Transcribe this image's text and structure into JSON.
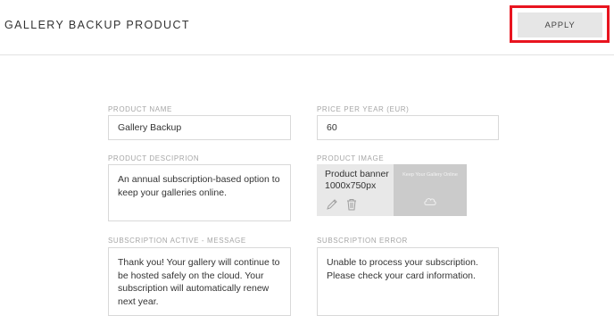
{
  "header": {
    "title": "GALLERY BACKUP PRODUCT",
    "apply_label": "APPLY",
    "highlight_color": "#e8141f"
  },
  "form": {
    "product_name": {
      "label": "PRODUCT NAME",
      "value": "Gallery Backup"
    },
    "price_per_year": {
      "label": "PRICE PER YEAR (EUR)",
      "value": "60"
    },
    "product_description": {
      "label": "PRODUCT DESCIPRION",
      "value": "An annual subscription-based option to keep your galleries online."
    },
    "product_image": {
      "label": "PRODUCT IMAGE",
      "banner_text": "Product banner 1000x750px",
      "thumbnail_caption": "Keep Your Gallery Online",
      "icons": [
        "pencil-icon",
        "trash-icon",
        "cloud-icon"
      ]
    },
    "subscription_active_message": {
      "label": "SUBSCRIPTION ACTIVE - MESSAGE",
      "value": "Thank you! Your gallery will continue to be hosted safely on the cloud. Your subscription will automatically renew next year."
    },
    "subscription_error": {
      "label": "SUBSCRIPTION ERROR",
      "value": "Unable to process your subscription. Please check your card information."
    }
  }
}
